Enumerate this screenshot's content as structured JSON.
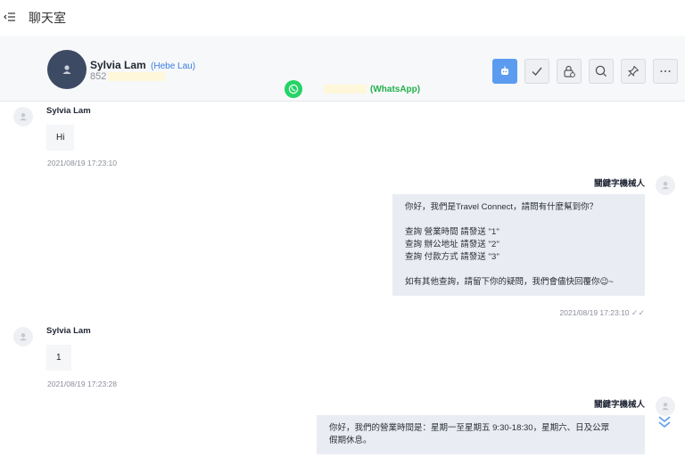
{
  "page": {
    "title": "聊天室"
  },
  "header": {
    "contact_name": "Sylvia Lam",
    "contact_alias": "(Hebe Lau)",
    "contact_phone": "852",
    "channel_label": "(WhatsApp)",
    "toolbar": [
      {
        "icon": "bot-icon",
        "active": true
      },
      {
        "icon": "check-icon",
        "active": false
      },
      {
        "icon": "lock-icon",
        "active": false
      },
      {
        "icon": "search-icon",
        "active": false
      },
      {
        "icon": "pin-icon",
        "active": false
      },
      {
        "icon": "more-icon",
        "active": false
      }
    ]
  },
  "messages": [
    {
      "sender": "Sylvia Lam",
      "text": "Hi",
      "time": "2021/08/19 17:23:10"
    },
    {
      "sender": "關鍵字機械人",
      "lines": [
        "你好，我們是Travel Connect，請問有什麼幫到你？",
        "",
        "查詢 營業時間 請發送 ''1''",
        "查詢 辦公地址 請發送 ''2''",
        "查詢 付款方式 請發送 ''3''",
        "",
        "如有其他查詢，請留下你的疑問，我們會儘快回覆你😉~"
      ],
      "time": "2021/08/19 17:23:10"
    },
    {
      "sender": "Sylvia Lam",
      "text": "1",
      "time": "2021/08/19 17:23:28"
    },
    {
      "sender": "關鍵字機械人",
      "lines": [
        "你好，我們的營業時間是：星期一至星期五 9:30-18:30，星期六、日及公眾",
        "假期休息。"
      ]
    }
  ],
  "colors": {
    "accent": "#5b9cf0",
    "whatsapp": "#25d366",
    "avatar": "#3d4a63"
  }
}
